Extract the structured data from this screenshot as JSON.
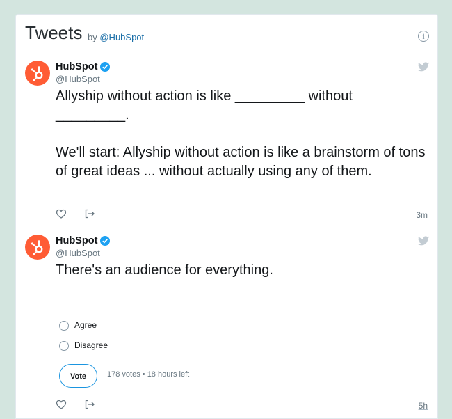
{
  "header": {
    "title": "Tweets",
    "by_prefix": "by",
    "handle": "@HubSpot"
  },
  "tweets": [
    {
      "author": "HubSpot",
      "handle": "@HubSpot",
      "text": "Allyship without action is like _________ without _________.\n\nWe'll start: Allyship without action is like a brainstorm of tons of great ideas ... without actually using any of them.",
      "timestamp": "3m"
    },
    {
      "author": "HubSpot",
      "handle": "@HubSpot",
      "text": "There's an audience for everything.",
      "timestamp": "5h",
      "poll": {
        "options": [
          "Agree",
          "Disagree"
        ],
        "vote_label": "Vote",
        "votes": "178 votes",
        "separator": "•",
        "time_left": "18 hours left"
      }
    }
  ],
  "colors": {
    "brand": "#ff5c35",
    "link": "#1b6fa8",
    "verified": "#1da1f2",
    "page_background": "#d3e5df"
  },
  "icons": [
    "info-icon",
    "hubspot-logo-icon",
    "verified-badge-icon",
    "twitter-bird-icon",
    "heart-icon",
    "share-icon"
  ]
}
